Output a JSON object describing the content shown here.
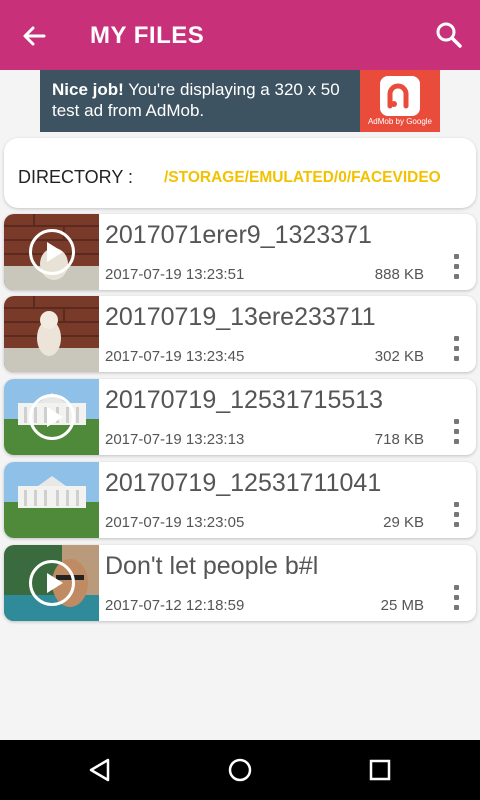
{
  "appbar": {
    "title": "MY FILES",
    "color": "#c8317a"
  },
  "ad": {
    "headline": "Nice job!",
    "body": " You're displaying a 320 x 50 test ad from AdMob.",
    "badge": "AdMob by Google"
  },
  "directory": {
    "label": "DIRECTORY :",
    "path": "/STORAGE/EMULATED/0/FACEVIDEO"
  },
  "files": [
    {
      "name": "2017071erer9_1323371",
      "date": "2017-07-19 13:23:51",
      "size": "888 KB",
      "thumb": "dog-bricks"
    },
    {
      "name": "20170719_13ere233711",
      "date": "2017-07-19 13:23:45",
      "size": "302 KB",
      "thumb": "dog-bricks"
    },
    {
      "name": "20170719_12531715513",
      "date": "2017-07-19 13:23:13",
      "size": "718 KB",
      "thumb": "white-house"
    },
    {
      "name": "20170719_12531711041",
      "date": "2017-07-19 13:23:05",
      "size": "29 KB",
      "thumb": "white-house"
    },
    {
      "name": "Don't let people b#l",
      "date": "2017-07-12 12:18:59",
      "size": "25 MB",
      "thumb": "man-selfie"
    }
  ]
}
